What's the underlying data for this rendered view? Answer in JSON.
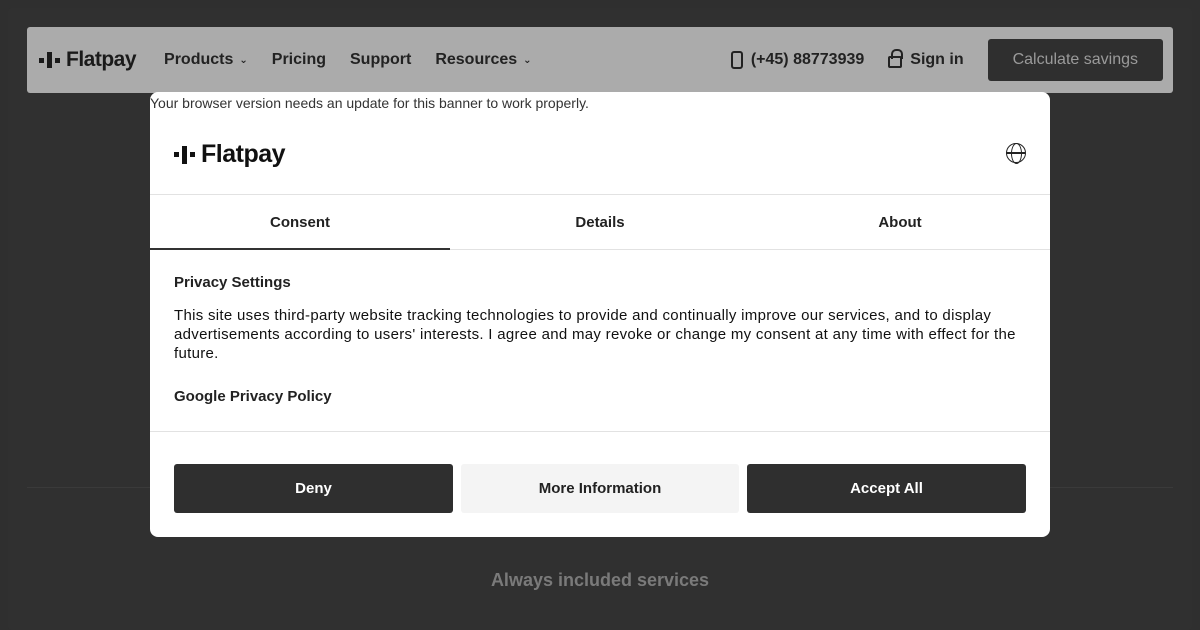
{
  "navbar": {
    "logo": "Flatpay",
    "items": [
      {
        "label": "Products",
        "dropdown": true
      },
      {
        "label": "Pricing",
        "dropdown": false
      },
      {
        "label": "Support",
        "dropdown": false
      },
      {
        "label": "Resources",
        "dropdown": true
      }
    ],
    "phone": "(+45) 88773939",
    "sign_in": "Sign in",
    "cta": "Calculate savings"
  },
  "background": {
    "heading": "Always included services"
  },
  "modal": {
    "browser_warning": "Your browser version needs an update for this banner to work properly.",
    "logo": "Flatpay",
    "tabs": [
      {
        "label": "Consent",
        "active": true
      },
      {
        "label": "Details",
        "active": false
      },
      {
        "label": "About",
        "active": false
      }
    ],
    "section_title": "Privacy Settings",
    "section_text": "This site uses third-party website tracking technologies to provide and continually improve our services, and to display advertisements according to users' interests. I agree and may revoke or change my consent at any time with effect for the future.",
    "policy_link": "Google Privacy Policy",
    "buttons": {
      "deny": "Deny",
      "more": "More Information",
      "accept": "Accept All"
    }
  },
  "colors": {
    "overlay": "#2f2f2f",
    "button_dark": "#2f2f2f",
    "button_light": "#f4f4f4",
    "modal_bg": "#ffffff"
  },
  "icons": {
    "logo": "flatpay-logo-icon",
    "phone": "phone-icon",
    "lock": "lock-icon",
    "globe": "globe-icon",
    "chevron": "chevron-down-icon"
  }
}
